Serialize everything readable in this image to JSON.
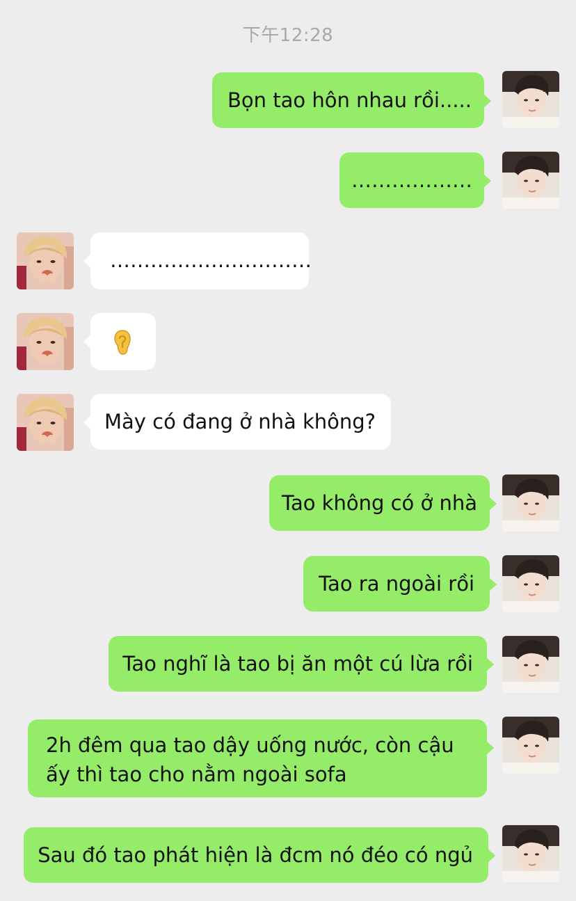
{
  "chat": {
    "timestamp": "下午12:28",
    "messages": [
      {
        "side": "me",
        "text": "Bọn tao hôn nhau rồi....."
      },
      {
        "side": "me",
        "text": "………………"
      },
      {
        "side": "other",
        "text": "…………………………"
      },
      {
        "side": "other",
        "icon": "ear-emoji"
      },
      {
        "side": "other",
        "text": "Mày có đang ở nhà không?"
      },
      {
        "side": "me",
        "text": "Tao không có ở nhà"
      },
      {
        "side": "me",
        "text": "Tao ra ngoài rồi"
      },
      {
        "side": "me",
        "text": "Tao nghĩ là tao bị ăn một cú lừa rồi"
      },
      {
        "side": "me",
        "text": "2h đêm qua tao dậy uống nước, còn cậu ấy thì tao cho nằm ngoài sofa"
      },
      {
        "side": "me",
        "text": "Sau đó tao phát hiện là đcm nó đéo có ngủ"
      }
    ]
  },
  "colors": {
    "background": "#ededed",
    "my_bubble": "#95ec69",
    "other_bubble": "#ffffff",
    "timestamp_text": "#a9a9a9"
  }
}
